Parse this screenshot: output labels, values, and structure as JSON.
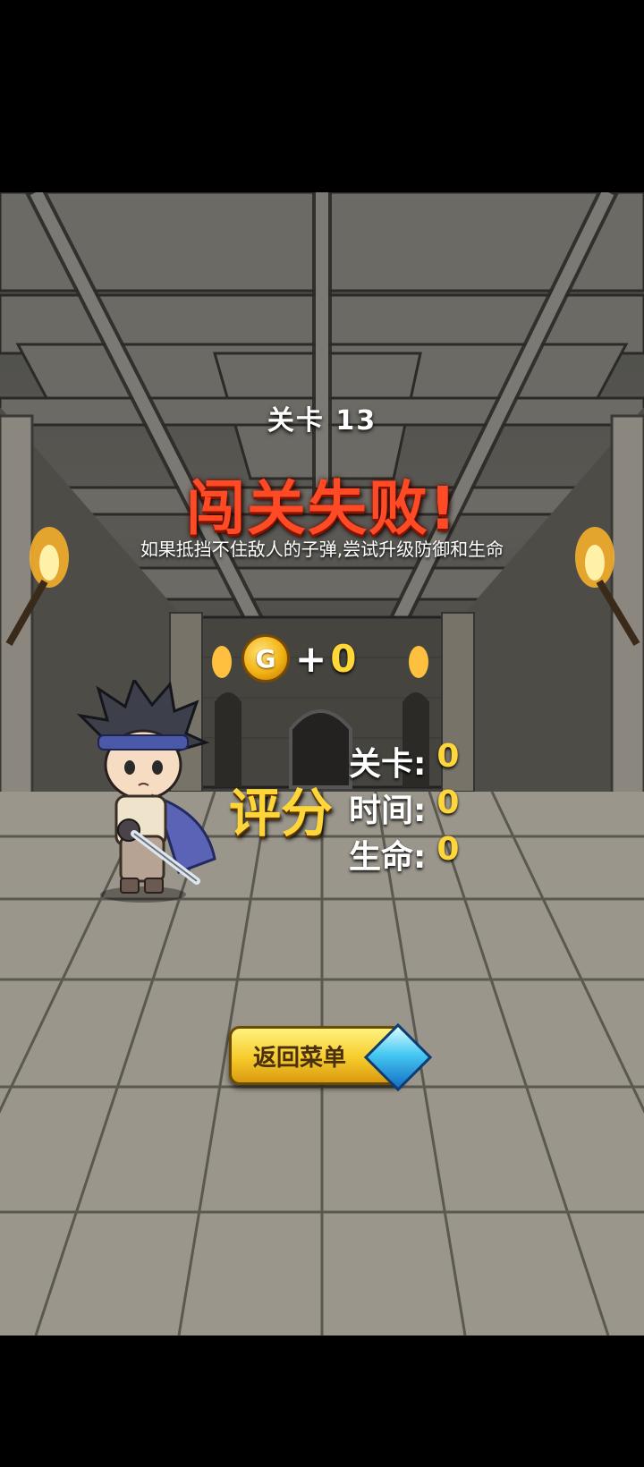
{
  "level_title": "关卡 13",
  "result_title": "闯关失败!",
  "hint": "如果抵挡不住敌人的子弹,尝试升级防御和生命",
  "reward": {
    "coin_letter": "G",
    "plus": "+",
    "value": "0"
  },
  "score": {
    "label": "评分",
    "rows": [
      {
        "label": "关卡:",
        "value": "0"
      },
      {
        "label": "时间:",
        "value": "0"
      },
      {
        "label": "生命:",
        "value": "0"
      }
    ]
  },
  "return_button_label": "返回菜单",
  "colors": {
    "fail_title": "#ff4a26",
    "score_gold": "#ffd63a",
    "button": "#f6cb2a"
  }
}
